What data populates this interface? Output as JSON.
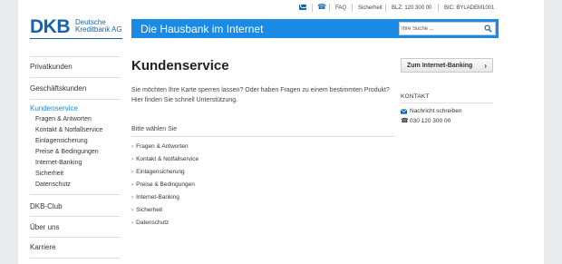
{
  "topbar": {
    "faq": "FAQ",
    "sicherheit": "Sicherheit",
    "blz": "BLZ: 120 300 00",
    "bic": "BIC: BYLADEM1001"
  },
  "logo": {
    "mark": "DKB",
    "line1": "Deutsche",
    "line2": "Kreditbank AG"
  },
  "header": {
    "title": "Die Hausbank im Internet",
    "search_placeholder": "Ihre Suche ..."
  },
  "sidebar": {
    "items": [
      {
        "label": "Privatkunden"
      },
      {
        "label": "Geschäftskunden"
      },
      {
        "label": "Kundenservice",
        "active": true,
        "subitems": [
          "Fragen & Antworten",
          "Kontakt & Notfallservice",
          "Einlagensicherung",
          "Preise & Bedingungen",
          "Internet-Banking",
          "Sicherheit",
          "Datenschutz"
        ]
      },
      {
        "label": "DKB-Club"
      },
      {
        "label": "Über uns"
      },
      {
        "label": "Karriere"
      }
    ]
  },
  "main": {
    "heading": "Kundenservice",
    "intro": "Sie möchten Ihre Karte sperren lassen? Oder haben Fragen zu einem bestimmten Produkt? Hier finden Sie schnell Unterstützung.",
    "choose_label": "Bitte wählen Sie",
    "choices": [
      "Fragen & Antworten",
      "Kontakt & Notfallservice",
      "Einlagensicherung",
      "Preise & Bedingungen",
      "Internet-Banking",
      "Sicherheit",
      "Datenschutz"
    ]
  },
  "right": {
    "button_label": "Zum Internet-Banking",
    "kontakt_title": "KONTAKT",
    "message_label": "Nachricht schreiben",
    "phone": "030 120 300 00"
  },
  "colors": {
    "brand_blue": "#1763ab",
    "header_blue": "#1a8ae4"
  },
  "icons": [
    "mail-icon",
    "phone-icon",
    "search-icon",
    "chevron-right-icon"
  ]
}
